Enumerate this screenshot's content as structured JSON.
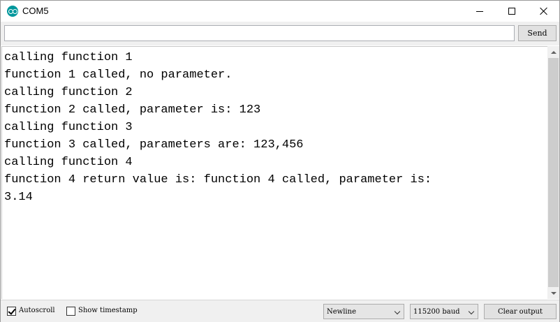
{
  "window": {
    "title": "COM5",
    "icon": "arduino-icon"
  },
  "input": {
    "value": "",
    "send_label": "Send"
  },
  "output": {
    "lines": [
      "calling function 1",
      "function 1 called, no parameter.",
      "calling function 2",
      "function 2 called, parameter is: 123",
      "calling function 3",
      "function 3 called, parameters are: 123,456",
      "calling function 4",
      "function 4 return value is: function 4 called, parameter is:",
      "3.14"
    ]
  },
  "footer": {
    "autoscroll_label": "Autoscroll",
    "autoscroll_checked": true,
    "timestamp_label": "Show timestamp",
    "timestamp_checked": false,
    "line_ending": "Newline",
    "baud": "115200 baud",
    "clear_label": "Clear output"
  },
  "colors": {
    "accent": "#00979c",
    "chrome": "#f0f0f0"
  }
}
